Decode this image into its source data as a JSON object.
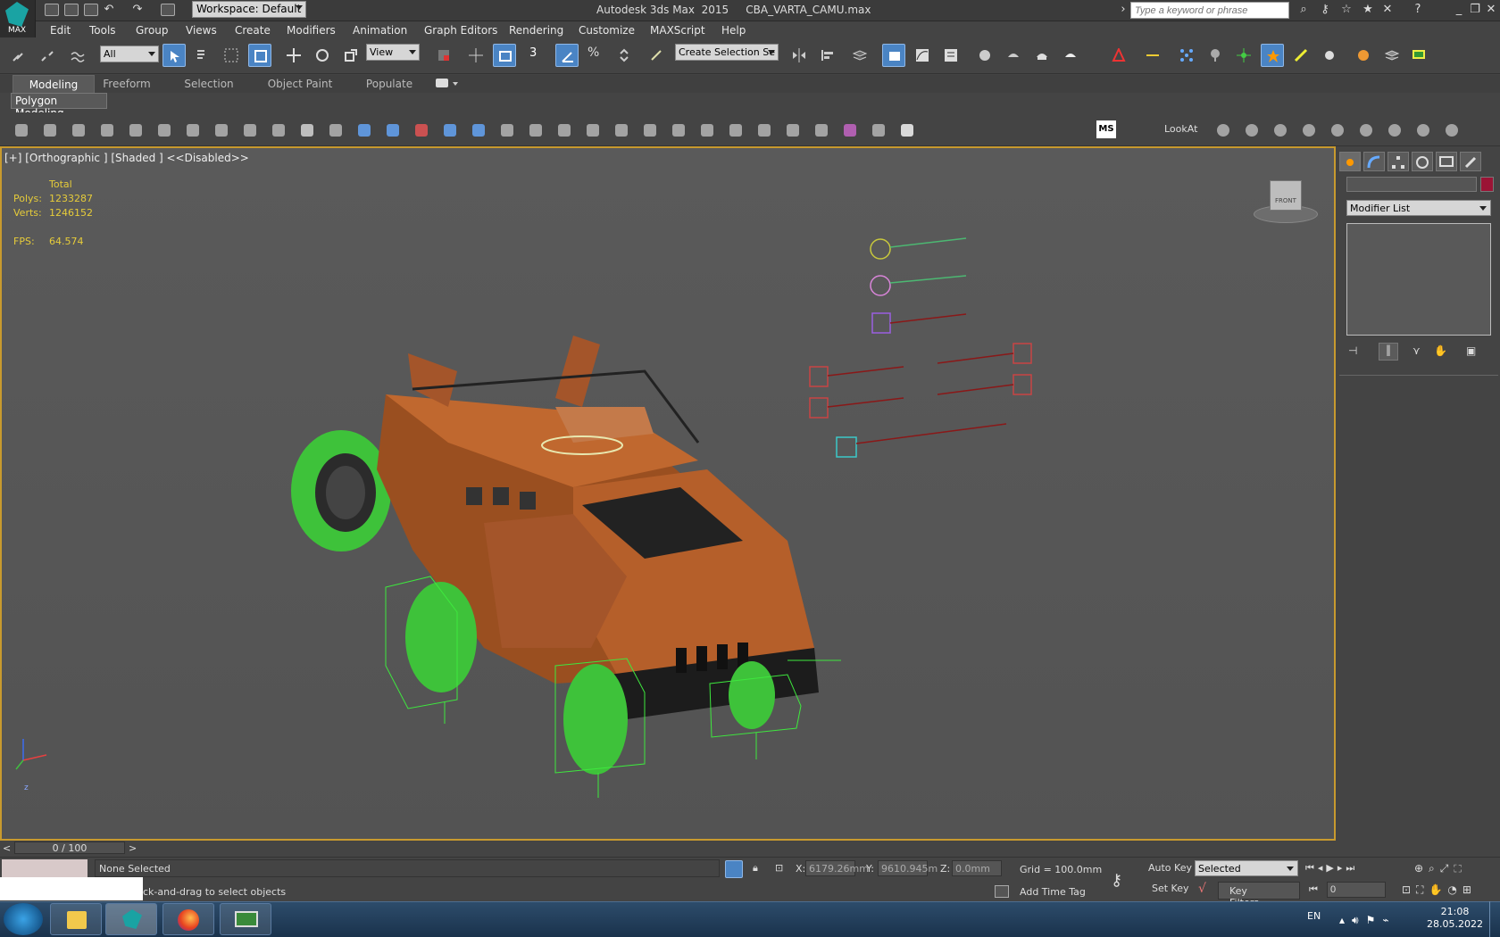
{
  "app": {
    "title": "Autodesk 3ds Max  2015     CBA_VARTA_CAMU.max",
    "logo_text": "MAX",
    "workspace_label": "Workspace: Default",
    "search_placeholder": "Type a keyword or phrase"
  },
  "menu": [
    "Edit",
    "Tools",
    "Group",
    "Views",
    "Create",
    "Modifiers",
    "Animation",
    "Graph Editors",
    "Rendering",
    "Customize",
    "MAXScript",
    "Help"
  ],
  "toolbar": {
    "selection_filter": "All",
    "ref_coord": "View",
    "named_selection": "Create Selection Se",
    "snap_label": "3"
  },
  "ribbon": {
    "tabs": [
      "Modeling",
      "Freeform",
      "Selection",
      "Object Paint",
      "Populate"
    ],
    "active_tab": "Modeling",
    "panel_label": "Polygon Modeling",
    "lookat_label": "LookAt",
    "ms_label": "MS"
  },
  "viewport": {
    "label": "[+] [Orthographic ] [Shaded ]  <<Disabled>>",
    "stats": {
      "total_label": "Total",
      "polys_label": "Polys:",
      "polys_value": "1233287",
      "verts_label": "Verts:",
      "verts_value": "1246152",
      "fps_label": "FPS:",
      "fps_value": "64.574"
    },
    "viewcube_label": "FRONT",
    "axis_label": "z",
    "border_color": "#c89a2e",
    "model_color": "#b8632e",
    "wheel_color": "#3ec23a"
  },
  "command_panel": {
    "modifier_list": "Modifier List",
    "color_swatch": "#9b1335"
  },
  "timeline": {
    "frame_display": "0 / 100",
    "current_frame": 0,
    "total_frames": 100
  },
  "status": {
    "selection": "None Selected",
    "prompt": "ck-and-drag to select objects",
    "x_label": "X:",
    "x_value": "6179.26mm",
    "y_label": "Y:",
    "y_value": "9610.945m",
    "z_label": "Z:",
    "z_value": "0.0mm",
    "grid": "Grid = 100.0mm",
    "add_time_tag": "Add Time Tag",
    "auto_key": "Auto Key",
    "set_key": "Set Key",
    "key_mode": "Selected",
    "key_filters": "Key Filters...",
    "frame_input": "0"
  },
  "taskbar": {
    "lang": "EN",
    "time": "21:08",
    "date": "28.05.2022"
  }
}
